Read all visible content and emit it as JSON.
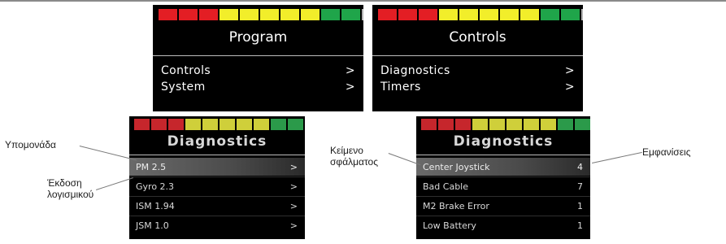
{
  "colors": {
    "red": "#e31e24",
    "yellow": "#f2ee2a",
    "green": "#1fa54a",
    "gray": "#b3b3b3",
    "red_dim": "#c6262c",
    "yellow_dim": "#cfcf3a",
    "green_dim": "#2b9a4a",
    "gray_dim": "#a8a8a8"
  },
  "battery_segments": [
    "red",
    "red",
    "red",
    "yellow",
    "yellow",
    "yellow",
    "yellow",
    "yellow",
    "green",
    "green",
    "gray"
  ],
  "program_panel": {
    "title": "Program",
    "items": [
      {
        "label": "Controls",
        "chevron": ">"
      },
      {
        "label": "System",
        "chevron": ">"
      }
    ]
  },
  "controls_panel": {
    "title": "Controls",
    "items": [
      {
        "label": "Diagnostics",
        "chevron": ">"
      },
      {
        "label": "Timers",
        "chevron": ">"
      }
    ]
  },
  "diag_modules_panel": {
    "title": "Diagnostics",
    "items": [
      {
        "label": "PM 2.5",
        "value": ">"
      },
      {
        "label": "Gyro 2.3",
        "value": ">"
      },
      {
        "label": "ISM 1.94",
        "value": ">"
      },
      {
        "label": "JSM 1.0",
        "value": ">"
      }
    ]
  },
  "diag_errors_panel": {
    "title": "Diagnostics",
    "items": [
      {
        "label": "Center Joystick",
        "value": "4"
      },
      {
        "label": "Bad Cable",
        "value": "7"
      },
      {
        "label": "M2 Brake Error",
        "value": "1"
      },
      {
        "label": "Low Battery",
        "value": "1"
      }
    ]
  },
  "callouts": {
    "module": "Υπομονάδα",
    "software_version_1": "Έκδοση",
    "software_version_2": "λογισμικού",
    "error_text_1": "Κείμενο",
    "error_text_2": "σφάλματος",
    "occurrences": "Εμφανίσεις"
  }
}
